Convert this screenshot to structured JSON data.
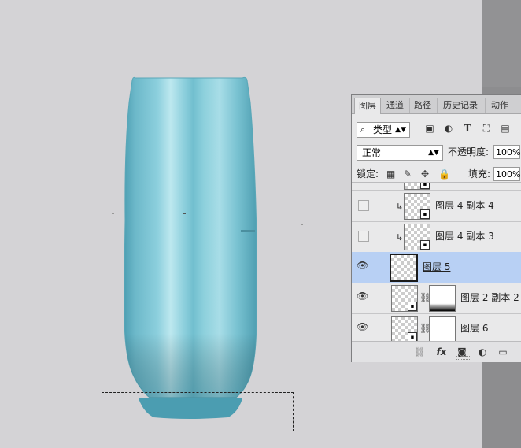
{
  "panel": {
    "tabs": [
      "图层",
      "通道",
      "路径",
      "历史记录",
      "动作"
    ],
    "filter": {
      "label": "类型",
      "icons": [
        "image-filter-icon",
        "adjustment-filter-icon",
        "type-filter-icon",
        "shape-filter-icon",
        "smart-object-filter-icon"
      ]
    },
    "blend_mode": "正常",
    "opacity": {
      "label": "不透明度:",
      "value": "100%"
    },
    "lock": {
      "label": "锁定:",
      "icons": [
        "lock-transparent-icon",
        "lock-paint-icon",
        "lock-position-icon",
        "lock-all-icon"
      ]
    },
    "fill": {
      "label": "填充:",
      "value": "100%"
    },
    "layers": [
      {
        "name": "",
        "visible": false,
        "clipped": false,
        "selected": false,
        "mask": false,
        "smart": true,
        "partial": true
      },
      {
        "name": "图层 4 副本 4",
        "visible": false,
        "clipped": true,
        "selected": false,
        "mask": false,
        "smart": true
      },
      {
        "name": "图层 4 副本 3",
        "visible": false,
        "clipped": true,
        "selected": false,
        "mask": false,
        "smart": true
      },
      {
        "name": "图层 5",
        "visible": true,
        "clipped": false,
        "selected": true,
        "mask": false,
        "smart": false
      },
      {
        "name": "图层 2 副本 2",
        "visible": true,
        "clipped": false,
        "selected": false,
        "mask": true,
        "smart": true
      },
      {
        "name": "图层 6",
        "visible": true,
        "clipped": false,
        "selected": false,
        "mask": true,
        "smart": true
      }
    ],
    "bottom_icons": [
      "link-layers-icon",
      "fx-icon",
      "add-mask-icon",
      "adjustment-layer-icon",
      "new-group-icon"
    ],
    "fx_label": "fx"
  },
  "colors": {
    "vase_light": "#b9e6ee",
    "vase_mid": "#7cc4d4",
    "vase_dark": "#4b9fb3",
    "selection": "#b8d0f4"
  }
}
